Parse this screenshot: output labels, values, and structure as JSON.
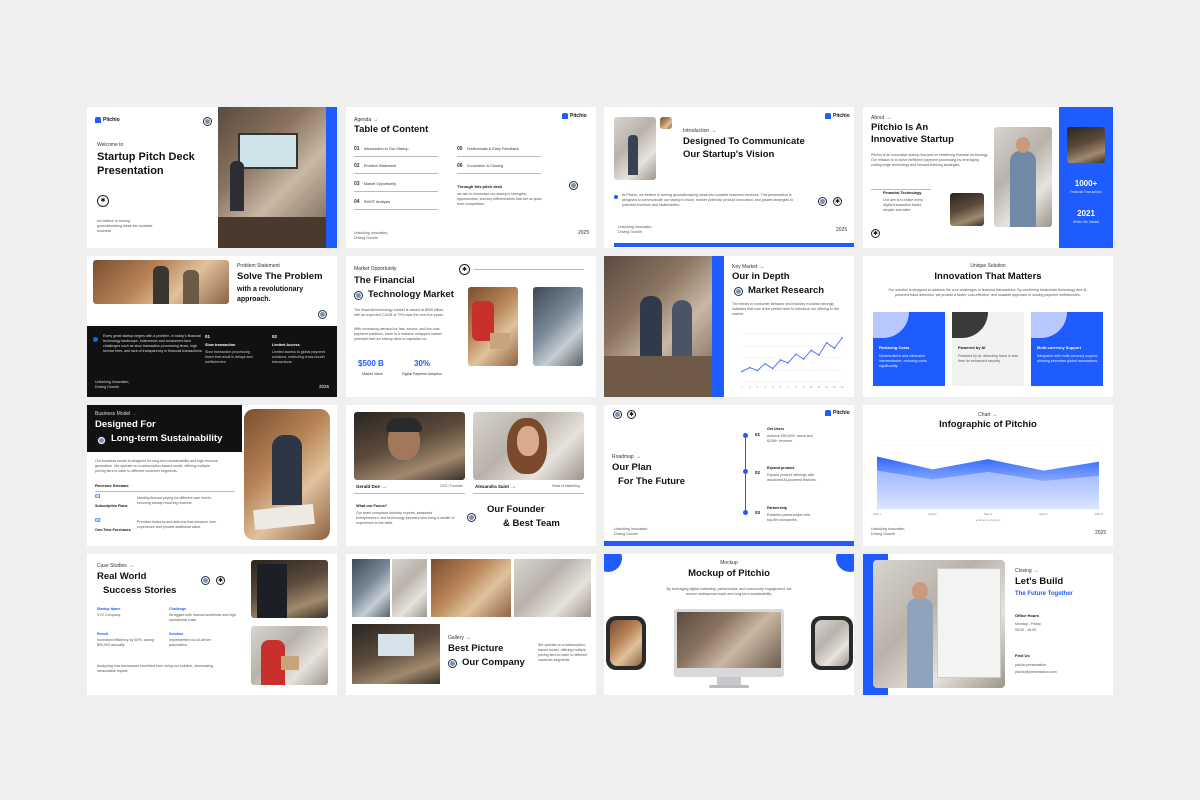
{
  "brand": {
    "name": "Pitchio",
    "accent": "#1f5cff",
    "dark": "#111111"
  },
  "footer": {
    "tagline_1": "Unlocking Innovation,",
    "tagline_2": "Driving Growth",
    "year": "2025"
  },
  "s1": {
    "welcome": "Welcome to",
    "title_1": "Startup Pitch Deck",
    "title_2": "Presentation",
    "body": "we believe in turning groundbreaking ideas into scalable business"
  },
  "s2": {
    "kicker": "Agenda",
    "title": "Table of Content",
    "items": [
      {
        "num": "01",
        "label": "Introduction to Our Startup"
      },
      {
        "num": "02",
        "label": "Problem Statement"
      },
      {
        "num": "03",
        "label": "Market Opportunity"
      },
      {
        "num": "04",
        "label": "SWOT Analysis"
      },
      {
        "num": "05",
        "label": "Testimonials & Early Feedback"
      },
      {
        "num": "06",
        "label": "Conclusion & Closing"
      }
    ],
    "sub_title": "Through this pitch deck",
    "sub_body": "we aim to showcase our startup's strengths, opportunities, and key differentiators that set us apart from competitors."
  },
  "s3": {
    "kicker": "Introduction",
    "title_1": "Designed To Communicate",
    "title_2": "Our Startup's Vision",
    "body": "At Pitchio, we believe in turning groundbreaking ideas into scalable business ventures. This presentation is designed to communicate our startup's vision, market potential, product innovation, and growth strategies to potential investors and stakeholders."
  },
  "s4": {
    "kicker": "About",
    "title_1": "Pitchio Is An",
    "title_2": "Innovative Startup",
    "body": "Pitchio is an innovative startup focused on redefining financial technology. Our mission is to solve inefficient payment processing by leveraging cutting-edge technology and forward-thinking strategies.",
    "tech_label": "Financial Technology",
    "tech_body": "Our aim is to make every digital transaction faster, simpler and safer.",
    "stat1_value": "1000+",
    "stat1_label": "Financial Transactions",
    "stat2_value": "2021",
    "stat2_label": "Where We Started"
  },
  "s5": {
    "kicker": "Problem Statement",
    "title_1": "Solve The Problem",
    "title_2": "with a revolutionary",
    "title_3": "approach.",
    "intro": "Every great startup begins with a problem. In today's financial technology landscape, businesses and consumers face challenges such as slow transaction processing times, high service fees, and lack of transparency in financial transactions.",
    "p1_num": "01",
    "p1_title": "Slow transaction",
    "p1_body": "Slow transaction processing times that result in delays and inefficiencies.",
    "p2_num": "02",
    "p2_title": "Limited Access",
    "p2_body": "Limited access to global payment solutions, restricting cross-border transactions."
  },
  "s6": {
    "kicker": "Market Opportunity",
    "title_1": "The Financial",
    "title_2": "Technology Market",
    "body_1": "The financial technology market is valued at $500 billion, with an expected CAGR of 75% over the next five years.",
    "body_2": "With increasing demand for fast, secure, and low-cost payment solutions, there is a massive untapped market potential that our startup aims to capitalize on.",
    "stat1_value": "$500 B",
    "stat1_label": "Market Value",
    "stat2_value": "30%",
    "stat2_label": "Digital Payment Adoption"
  },
  "s7": {
    "kicker": "Key Market",
    "title_1": "Our in Depth",
    "title_2": "Market Research",
    "body": "The trends in consumer behavior and industry evolution strongly indicates that now is the perfect time to introduce our offering to the market."
  },
  "chart_data": [
    {
      "type": "line",
      "x": [
        "1",
        "2",
        "3",
        "4",
        "5",
        "6",
        "7",
        "8",
        "9",
        "10",
        "11",
        "12",
        "13",
        "14"
      ],
      "series": [
        {
          "values": [
            22,
            30,
            24,
            38,
            28,
            46,
            40,
            58,
            48,
            66,
            56,
            82,
            70,
            92
          ]
        }
      ],
      "ylim": [
        0,
        100
      ]
    },
    {
      "type": "area",
      "x": [
        "Data 1",
        "Data 2",
        "Data 3",
        "Data 4",
        "Data 5"
      ],
      "series": [
        {
          "values": [
            82,
            62,
            78,
            60,
            74
          ]
        },
        {
          "values": [
            60,
            46,
            58,
            44,
            52
          ]
        }
      ],
      "ylim": [
        0,
        100
      ],
      "legend": [
        "● Series 1",
        "● Series 2"
      ]
    }
  ],
  "s8": {
    "kicker": "Unique Solution",
    "title": "Innovation That Matters",
    "body": "Our solution is designed to address the core challenges in financial transactions. By combining blockchain technology and AI-powered fraud detection, we provide a faster, cost-effective, and scalable approach to solving payment inefficiencies.",
    "cards": [
      {
        "title": "Reducing Costs",
        "body": "Decentralized and eliminates intermediaries, reducing costs significantly."
      },
      {
        "title": "Powered by AI",
        "body": "Powered by AI, detecting fraud in real-time for enhanced security."
      },
      {
        "title": "Multi-currency Support",
        "body": "Integrated with multi-currency support, allowing seamless global transactions."
      }
    ]
  },
  "s9": {
    "kicker": "Business Model",
    "title_1": "Designed For",
    "title_2": "Long-term Sustainability",
    "body": "Our business model is designed for long-term sustainability and high revenue generation. We operate on a subscription-based model, offering multiple pricing tiers to cater to different customer segments.",
    "section": "Revenue Streams",
    "r1_num": "01",
    "r1_title": "Subscription Plans",
    "r1_body": "Monthly/Annual pricing for different user levels, ensuring steady recurring revenue.",
    "r2_num": "02",
    "r2_title": "One-Time Purchases",
    "r2_body": "Premium features and add-ons that enhance user experience and provide additional value."
  },
  "s10": {
    "name1": "Gerald Doe",
    "role1": "CEO / Founder",
    "name2": "Alexandra Saint",
    "role2": "Head of Marketing",
    "focus_title": "What our Focus?",
    "focus_body": "Our team comprises industry experts, seasoned entrepreneurs, and technology pioneers who bring a wealth of experience to the table.",
    "title_1": "Our Founder",
    "title_2": "& Best Team"
  },
  "s11": {
    "kicker": "Roadmap",
    "title_1": "Our Plan",
    "title_2": "For The Future",
    "steps": [
      {
        "num": "01",
        "title": "Get Users",
        "body": "Achieve 500,000+ users and $10M+ revenue."
      },
      {
        "num": "02",
        "title": "Expand product",
        "body": "Expand product offerings with advanced AI-powered features."
      },
      {
        "num": "03",
        "title": "Partnership",
        "body": "Establish partnerships with top-tier companies."
      }
    ]
  },
  "s12": {
    "kicker": "Chart",
    "title": "Infographic of Pitchio"
  },
  "s13": {
    "kicker": "Case Studies",
    "title_1": "Real World",
    "title_2": "Success Stories",
    "c1_label": "Startup Name",
    "c1_value": "XYZ Company",
    "c2_label": "Challenge",
    "c2_value": "Struggled with manual workflows and high operational costs.",
    "c3_label": "Result",
    "c3_value": "Increased efficiency by 60%, saving $50,000 annually.",
    "c4_label": "Solution",
    "c4_value": "Implemented our AI-driven automation.",
    "body": "Analyzing how businesses benefited from using our solution, showcasing measurable impact."
  },
  "s14": {
    "kicker": "Gallery",
    "title_1": "Best Picture",
    "title_2": "Our Company",
    "body": "We operate on a subscription-based model, offering multiple pricing tiers to cater to different customer segments."
  },
  "s15": {
    "kicker": "Mockup",
    "title": "Mockup of Pitchio",
    "body": "By leveraging digital marketing, partnerships, and community engagement, we ensure widespread reach and long-term sustainability."
  },
  "s16": {
    "kicker": "Closing",
    "title_1": "Let's Build",
    "title_2": "The Future Together",
    "hours_label": "Office Hours",
    "hours_days": "Monday - Friday",
    "hours_time": "08:00 - 16:00",
    "find_label": "Find Us",
    "web": "pitchio.presentation",
    "email": "pitchio@presentation.com"
  }
}
